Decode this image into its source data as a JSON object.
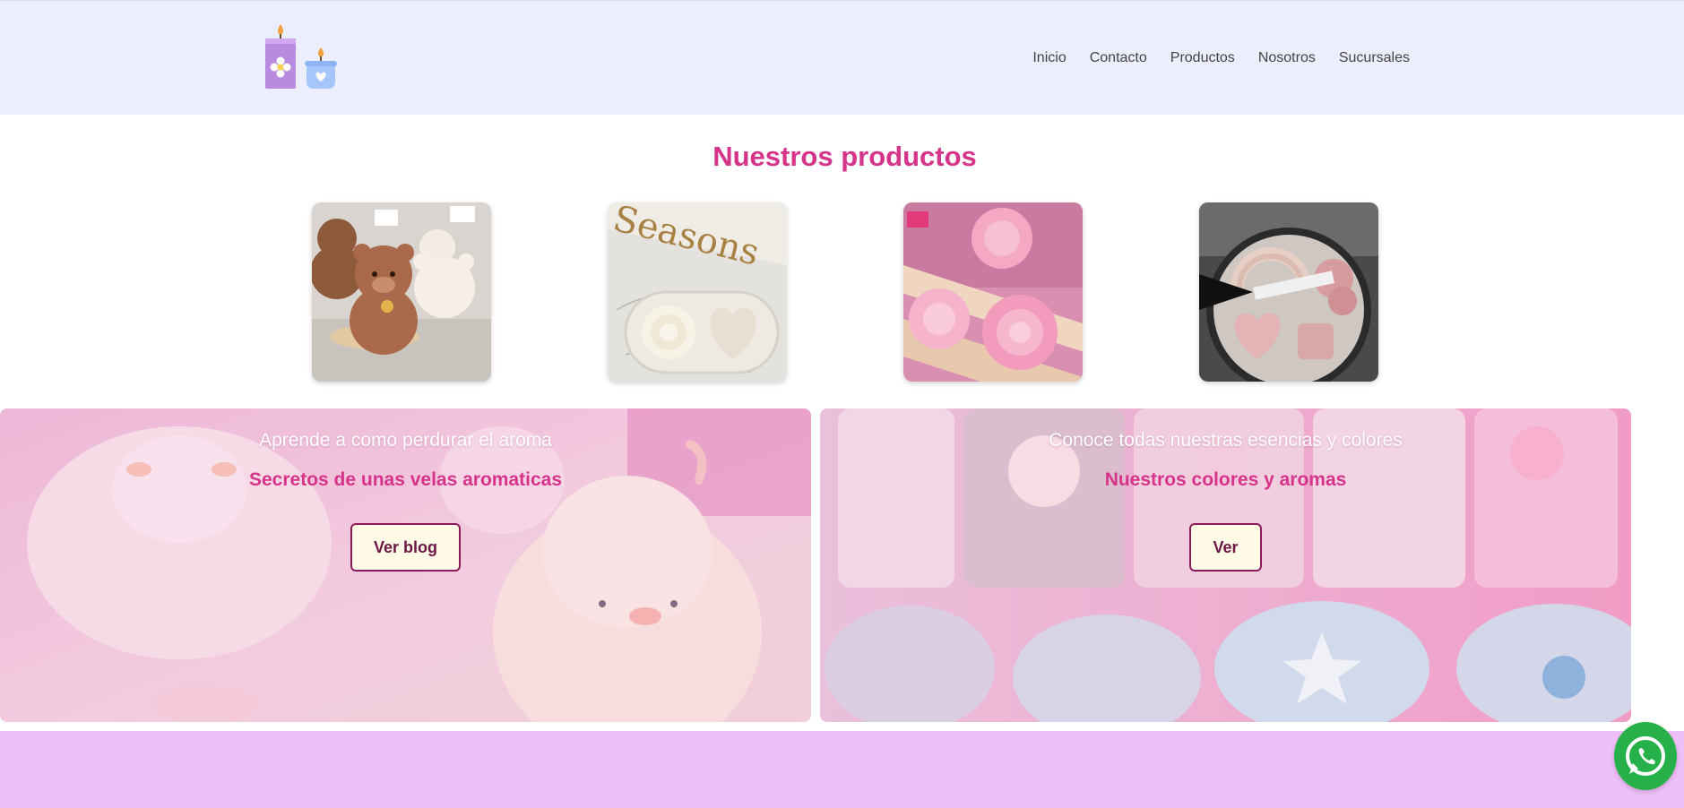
{
  "nav": {
    "items": [
      "Inicio",
      "Contacto",
      "Productos",
      "Nosotros",
      "Sucursales"
    ]
  },
  "products": {
    "title": "Nuestros productos"
  },
  "banners": [
    {
      "subtitle": "Aprende a como perdurar el aroma",
      "headline": "Secretos de unas velas aromaticas",
      "button": "Ver blog"
    },
    {
      "subtitle": "Conoce todas nuestras esencias y colores",
      "headline": "Nuestros colores y aromas",
      "button": "Ver"
    }
  ],
  "colors": {
    "header_bg": "#eceefd",
    "accent": "#d6338a",
    "button_bg": "#fffbe6",
    "button_border": "#8a1a5c",
    "footer_bg": "#efc0f8",
    "whatsapp": "#25b04a"
  },
  "icons": {
    "logo": "candles-icon",
    "floating": "whatsapp-icon"
  }
}
